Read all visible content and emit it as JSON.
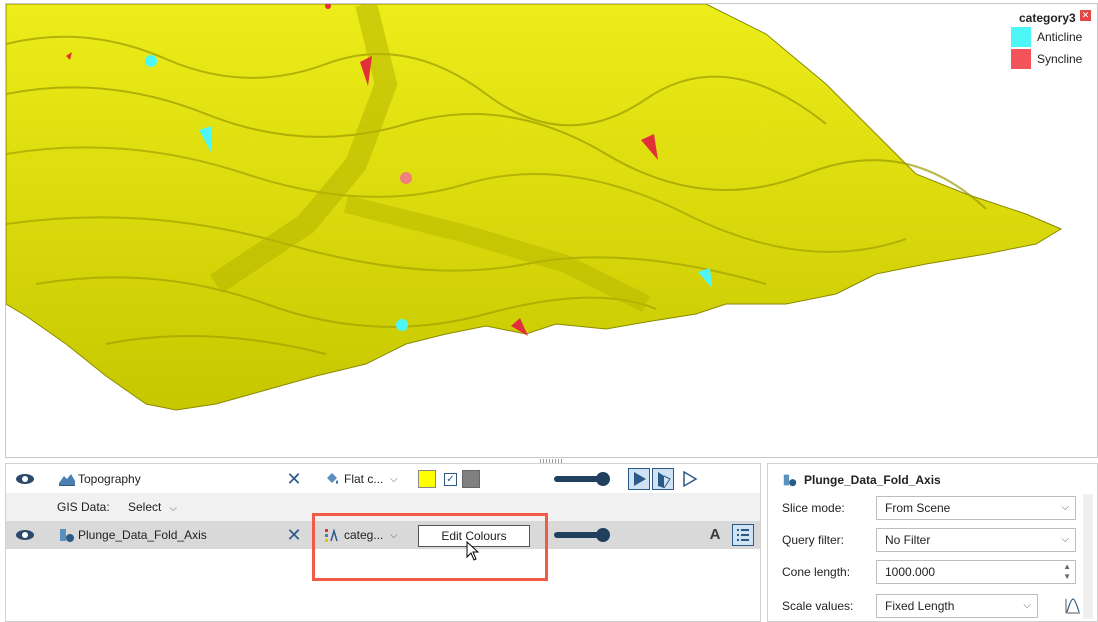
{
  "scene": {
    "legend": {
      "title": "category3",
      "items": [
        {
          "label": "Anticline",
          "color": "#4df7f7"
        },
        {
          "label": "Syncline",
          "color": "#f5535a"
        }
      ]
    },
    "colors": {
      "surface": "#e6e612",
      "surface_dark": "#b5b500",
      "background": "#ffffff"
    }
  },
  "shapes": {
    "topography": {
      "label": "Topography",
      "color_mode": "Flat c...",
      "flat_color": "#ffff00",
      "back_color": "#808080",
      "backface_checked": true,
      "opacity": 1.0
    },
    "gis": {
      "label": "GIS Data:",
      "select": "Select"
    },
    "plunge": {
      "label": "Plunge_Data_Fold_Axis",
      "color_mode": "categ...",
      "edit_button": "Edit Colours",
      "opacity": 1.0,
      "label_icon": "A"
    }
  },
  "properties": {
    "title": "Plunge_Data_Fold_Axis",
    "fields": [
      {
        "label": "Slice mode:",
        "value": "From Scene"
      },
      {
        "label": "Query filter:",
        "value": "No Filter"
      },
      {
        "label": "Cone length:",
        "value": "1000.000"
      },
      {
        "label": "Scale values:",
        "value": "Fixed Length"
      }
    ]
  },
  "accent_colors": {
    "highlight": "#f05a47",
    "ui_blue": "#2c5a86",
    "slider": "#21405e"
  }
}
